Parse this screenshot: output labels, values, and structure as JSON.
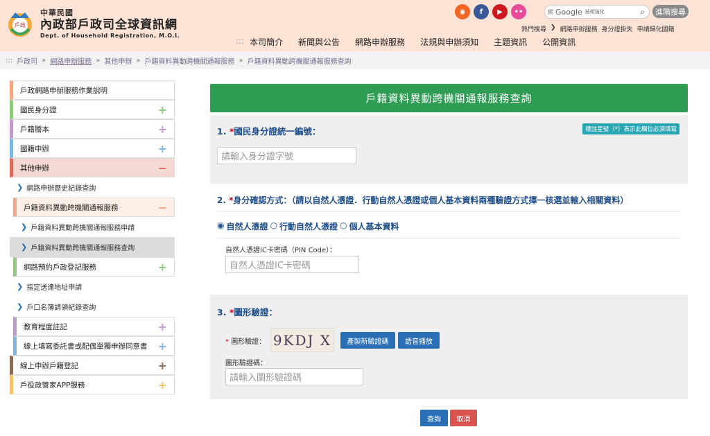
{
  "header": {
    "logo_badge": "戶政",
    "logo_line1": "中華民國",
    "logo_line2": "內政部戶政司全球資訊網",
    "logo_line3": "Dept. of Household Registration, M.O.I.",
    "social": [
      {
        "icon": "rss-icon",
        "glyph": "◉",
        "color": "#f26522"
      },
      {
        "icon": "facebook-icon",
        "glyph": "f",
        "color": "#3b5998"
      },
      {
        "icon": "youtube-icon",
        "glyph": "▶",
        "color": "#cc181e"
      },
      {
        "icon": "flickr-icon",
        "glyph": "••",
        "color": "#e64c9a"
      }
    ],
    "search_prefix": "網",
    "search_google": "Google",
    "search_suffix": "技術強化",
    "advanced_search": "進階搜尋",
    "hot_label": "熱門搜尋",
    "hot_items": [
      "網路申辦服務",
      "身分證掛失",
      "申請歸化國籍"
    ],
    "nav": [
      "本司簡介",
      "新聞與公告",
      "網路申辦服務",
      "法規與申辦須知",
      "主題資訊",
      "公開資訊"
    ]
  },
  "breadcrumb": [
    "戶政司",
    "網路申辦服務",
    "其他申辦",
    "戶籍資料異動跨機關通報服務",
    "戶籍資料異動跨機關通報服務查詢"
  ],
  "sidebar": {
    "items": [
      {
        "label": "戶政網路申辦服務作業說明",
        "color": "#f0a986",
        "sign": ""
      },
      {
        "label": "國民身分證",
        "color": "#8fc97f",
        "sign": "+"
      },
      {
        "label": "戶籍謄本",
        "color": "#c19bd0",
        "sign": "+"
      },
      {
        "label": "國籍申辦",
        "color": "#7fb6e3",
        "sign": "+"
      },
      {
        "label": "其他申辦",
        "color": "#e06a5c",
        "sign": "−"
      }
    ],
    "sub1": "網路申辦歷史紀錄查詢",
    "sub_group": {
      "label": "戶籍資料異動跨機關通報服務",
      "sign": "−"
    },
    "sub_items": [
      "戶籍資料異動跨機關通報服務申請",
      "戶籍資料異動跨機關通報服務查詢"
    ],
    "items2": [
      {
        "label": "網路預約戶政登記服務",
        "color": "#8fc97f",
        "sign": "+"
      }
    ],
    "sub2": [
      "指定送達地址申請",
      "戶口名簿請領紀錄查詢"
    ],
    "items3": [
      {
        "label": "教育程度註記",
        "color": "#c19bd0",
        "sign": "+"
      },
      {
        "label": "線上填寫委託書或配偶單獨申辦同意書",
        "color": "#7fb6e3",
        "sign": "+"
      },
      {
        "label": "線上申辦戶籍登記",
        "color": "#8a6a55",
        "sign": "+"
      },
      {
        "label": "戶役政管家APP服務",
        "color": "#f0c36a",
        "sign": "+"
      }
    ]
  },
  "main": {
    "title": "戶籍資料異動跨機關通報服務查詢",
    "sec1": {
      "num": "1.",
      "star": "*",
      "title": "國民身分證統一編號：",
      "note": "標註星號（*）表示此欄位必須填寫",
      "placeholder": "請輸入身分證字號"
    },
    "sec2": {
      "num": "2.",
      "star": "*",
      "title": "身分確認方式：（請以自然人憑證．行動自然人憑證或個人基本資料兩種驗證方式擇一核選並輸入相關資料）",
      "options": [
        "自然人憑證",
        "行動自然人憑證",
        "個人基本資料"
      ],
      "pin_label": "自然人憑證IC卡密碼（PIN Code）：",
      "pin_placeholder": "自然人憑證IC卡密碼"
    },
    "sec3": {
      "num": "3.",
      "star": "*",
      "title": "圖形驗證：",
      "captcha_label": "圖形驗證：",
      "captcha_text": "9KDJ X",
      "refresh": "產製新驗證碼",
      "audio": "語音播放",
      "code_label": "圖形驗證碼：",
      "code_placeholder": "請輸入圖形驗證碼"
    },
    "query": "查詢",
    "cancel": "取消"
  }
}
